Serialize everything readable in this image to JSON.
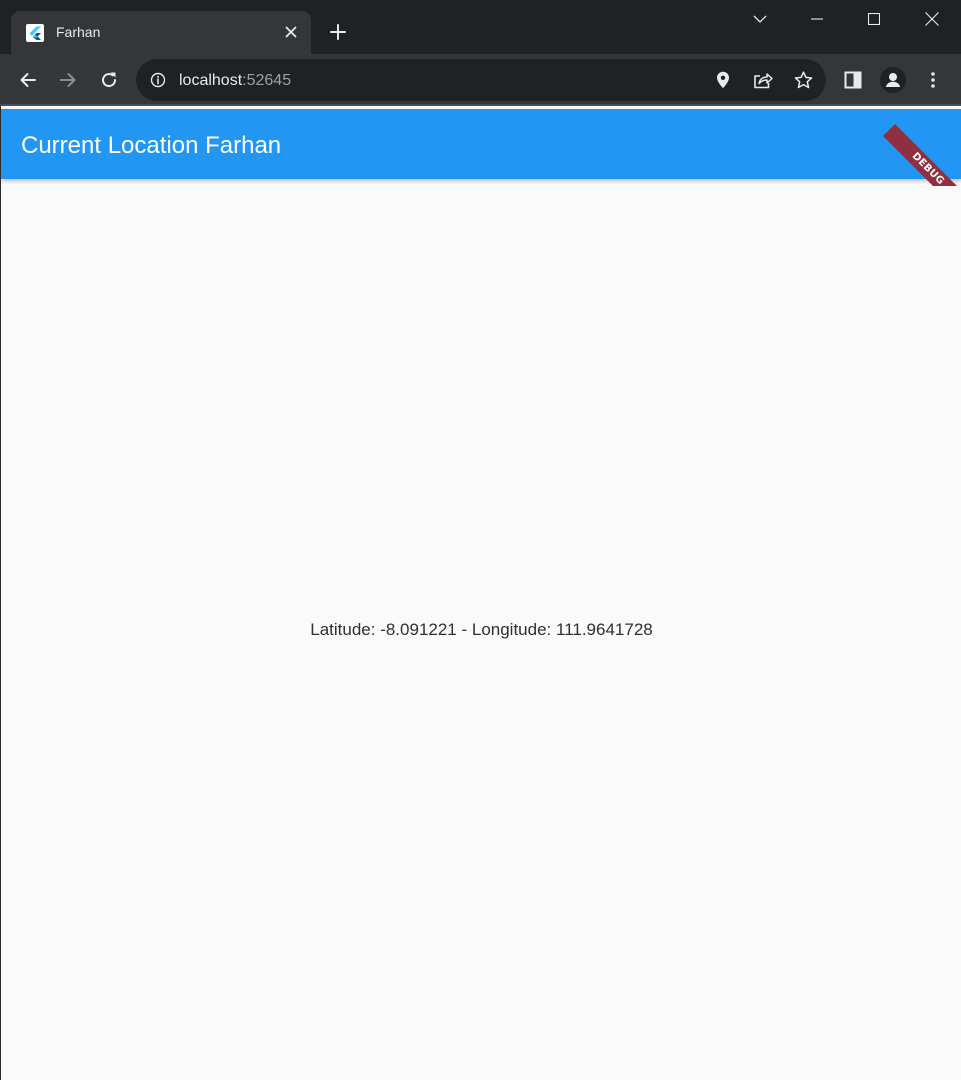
{
  "browser": {
    "tab": {
      "title": "Farhan",
      "favicon": "flutter-icon"
    },
    "omnibox": {
      "host": "localhost",
      "port": ":52645"
    },
    "colors": {
      "frame": "#202124",
      "toolbar": "#35363a",
      "omnibox": "#202124"
    }
  },
  "app": {
    "appbar_title": "Current Location Farhan",
    "location_text": "Latitude: -8.091221 - Longitude: 111.9641728",
    "debug_banner": "DEBUG",
    "colors": {
      "primary": "#2196f3",
      "background": "#fafafa",
      "debug_banner": "#8e3040"
    }
  }
}
